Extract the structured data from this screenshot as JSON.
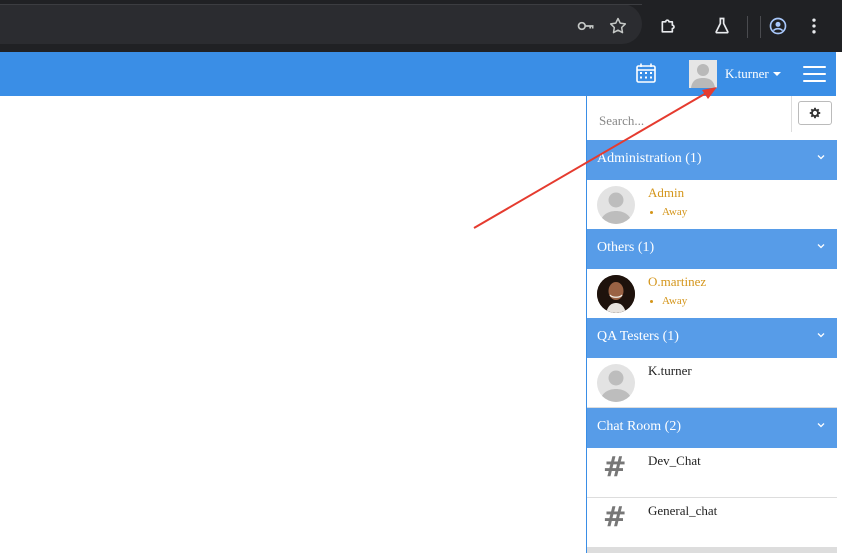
{
  "browser": {
    "icons": [
      "key-icon",
      "star-icon",
      "extensions-icon",
      "labs-icon",
      "profile-icon",
      "menu-dots-icon"
    ]
  },
  "header": {
    "user_name": "K.turner",
    "accent": "#3a8ee6"
  },
  "sidebar": {
    "search_placeholder": "Search...",
    "groups": [
      {
        "title": "Administration (1)",
        "items": [
          {
            "name": "Admin",
            "status": "Away",
            "avatar": "default"
          }
        ]
      },
      {
        "title": "Others (1)",
        "items": [
          {
            "name": "O.martinez",
            "status": "Away",
            "avatar": "photo"
          }
        ]
      },
      {
        "title": "QA Testers (1)",
        "items": [
          {
            "name": "K.turner",
            "status": "",
            "avatar": "default"
          }
        ]
      },
      {
        "title": "Chat Room (2)",
        "items": [
          {
            "name": "Dev_Chat",
            "type": "channel"
          },
          {
            "name": "General_chat",
            "type": "channel"
          }
        ]
      }
    ],
    "colors": {
      "group_header": "#579ce8",
      "away_name": "#d4951a",
      "active_name": "#222222"
    }
  }
}
